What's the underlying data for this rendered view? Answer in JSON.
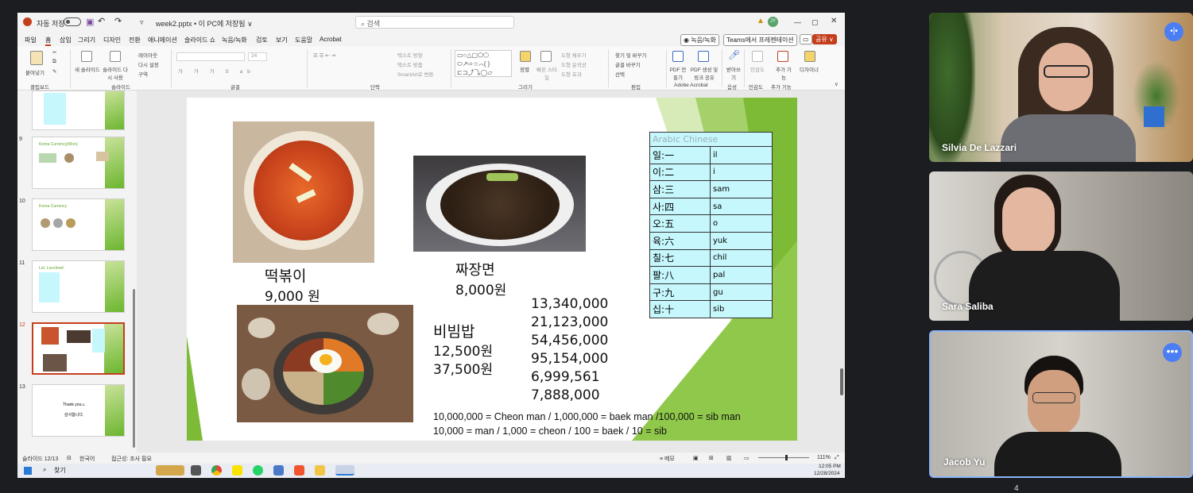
{
  "window": {
    "autosave_label": "자동 저장",
    "autosave_state": "끔",
    "file_title": "week2.pptx • 이 PC에 저장됨 ∨",
    "search_placeholder": "검색",
    "avatar_initials": "JY",
    "record_button": "◉ 녹음/녹화",
    "teams_button": "Teams에서 프레젠테이션",
    "share_button": "공유 ∨"
  },
  "menu": {
    "items": [
      "파일",
      "홈",
      "삽입",
      "그리기",
      "디자인",
      "전환",
      "애니메이션",
      "슬라이드 쇼",
      "녹음/녹화",
      "검토",
      "보기",
      "도움말",
      "Acrobat"
    ]
  },
  "ribbon": {
    "paste": "붙여넣기",
    "new_slide": "새 슬라이드",
    "reuse_slide": "슬라이드 다시 사용",
    "layout": "레이아웃",
    "reset": "다시 설정",
    "section": "구역",
    "font_size": "24",
    "text_direction": "텍스트 방향",
    "text_align": "텍스트 맞춤",
    "smartart": "SmartArt로 변환",
    "arrange": "정렬",
    "quick_styles": "빠른 스타일",
    "shape_fill": "도형 채우기",
    "shape_outline": "도형 윤곽선",
    "shape_effects": "도형 효과",
    "find": "찾기 및 바꾸기",
    "replace_font": "글꼴 바꾸기",
    "select": "선택",
    "pdf_create": "PDF 만들기",
    "pdf_share": "PDF 생성 및 링크 공유",
    "dictate": "받아쓰기",
    "sensitivity": "민감도",
    "addins": "추가 기능",
    "designer": "디자이너",
    "groups": [
      "클립보드",
      "슬라이드",
      "글꼴",
      "단락",
      "그리기",
      "편집",
      "Adobe Acrobat",
      "음성",
      "민감도",
      "추가 기능"
    ]
  },
  "thumbnails": [
    {
      "num": "9",
      "title": "Korea Currency(Won)"
    },
    {
      "num": "10",
      "title": "Korea Currency"
    },
    {
      "num": "11",
      "title": "Let. Lunchme!"
    },
    {
      "num": "12",
      "title": ""
    },
    {
      "num": "13",
      "title": "Thank you☺",
      "subtitle": "감사합니다."
    }
  ],
  "slide": {
    "tteokbokki_name": "떡볶이",
    "tteokbokki_price": "9,000 원",
    "jjajang_name": "짜장면",
    "jjajang_price": "8,000원",
    "bibimbap_name": "비빔밥",
    "bibimbap_price1": "12,500원",
    "bibimbap_price2": "37,500원",
    "numbers": [
      "13,340,000",
      "21,123,000",
      "54,456,000",
      "95,154,000",
      "6,999,561",
      "7,888,000"
    ],
    "footer_line1": "10,000,000 = Cheon man  /  1,000,000 = baek man  /100,000 = sib man",
    "footer_line2": "10,000 = man    /   1,000 = cheon     /     100 = baek  /     10 = sib",
    "table_header": "Arabic Chinese",
    "table_rows": [
      {
        "k": "일:一",
        "r": "il"
      },
      {
        "k": "이:二",
        "r": "i"
      },
      {
        "k": "삼:三",
        "r": "sam"
      },
      {
        "k": "사:四",
        "r": "sa"
      },
      {
        "k": "오:五",
        "r": "o"
      },
      {
        "k": "육:六",
        "r": "yuk"
      },
      {
        "k": "칠:七",
        "r": "chil"
      },
      {
        "k": "팔:八",
        "r": "pal"
      },
      {
        "k": "구:九",
        "r": "gu"
      },
      {
        "k": "십:十",
        "r": "sib"
      }
    ]
  },
  "status": {
    "slide_count": "슬라이드 12/13",
    "language": "한국어",
    "accessibility": "접근성: 조사 필요",
    "notes": "≡ 메모",
    "zoom": "111%"
  },
  "taskbar": {
    "search": "찾기",
    "time": "12:05 PM",
    "date": "12/28/2024"
  },
  "participants": [
    {
      "name": "Silvia De Lazzari"
    },
    {
      "name": "Sara Saliba"
    },
    {
      "name": "Jacob Yu"
    }
  ],
  "participant_overflow": "4",
  "colors": {
    "slide_green": "#7dbb37",
    "table_cyan": "#c5f7fc",
    "ppt_red": "#c43e1c",
    "active_tile_border": "#8ab4f8"
  }
}
